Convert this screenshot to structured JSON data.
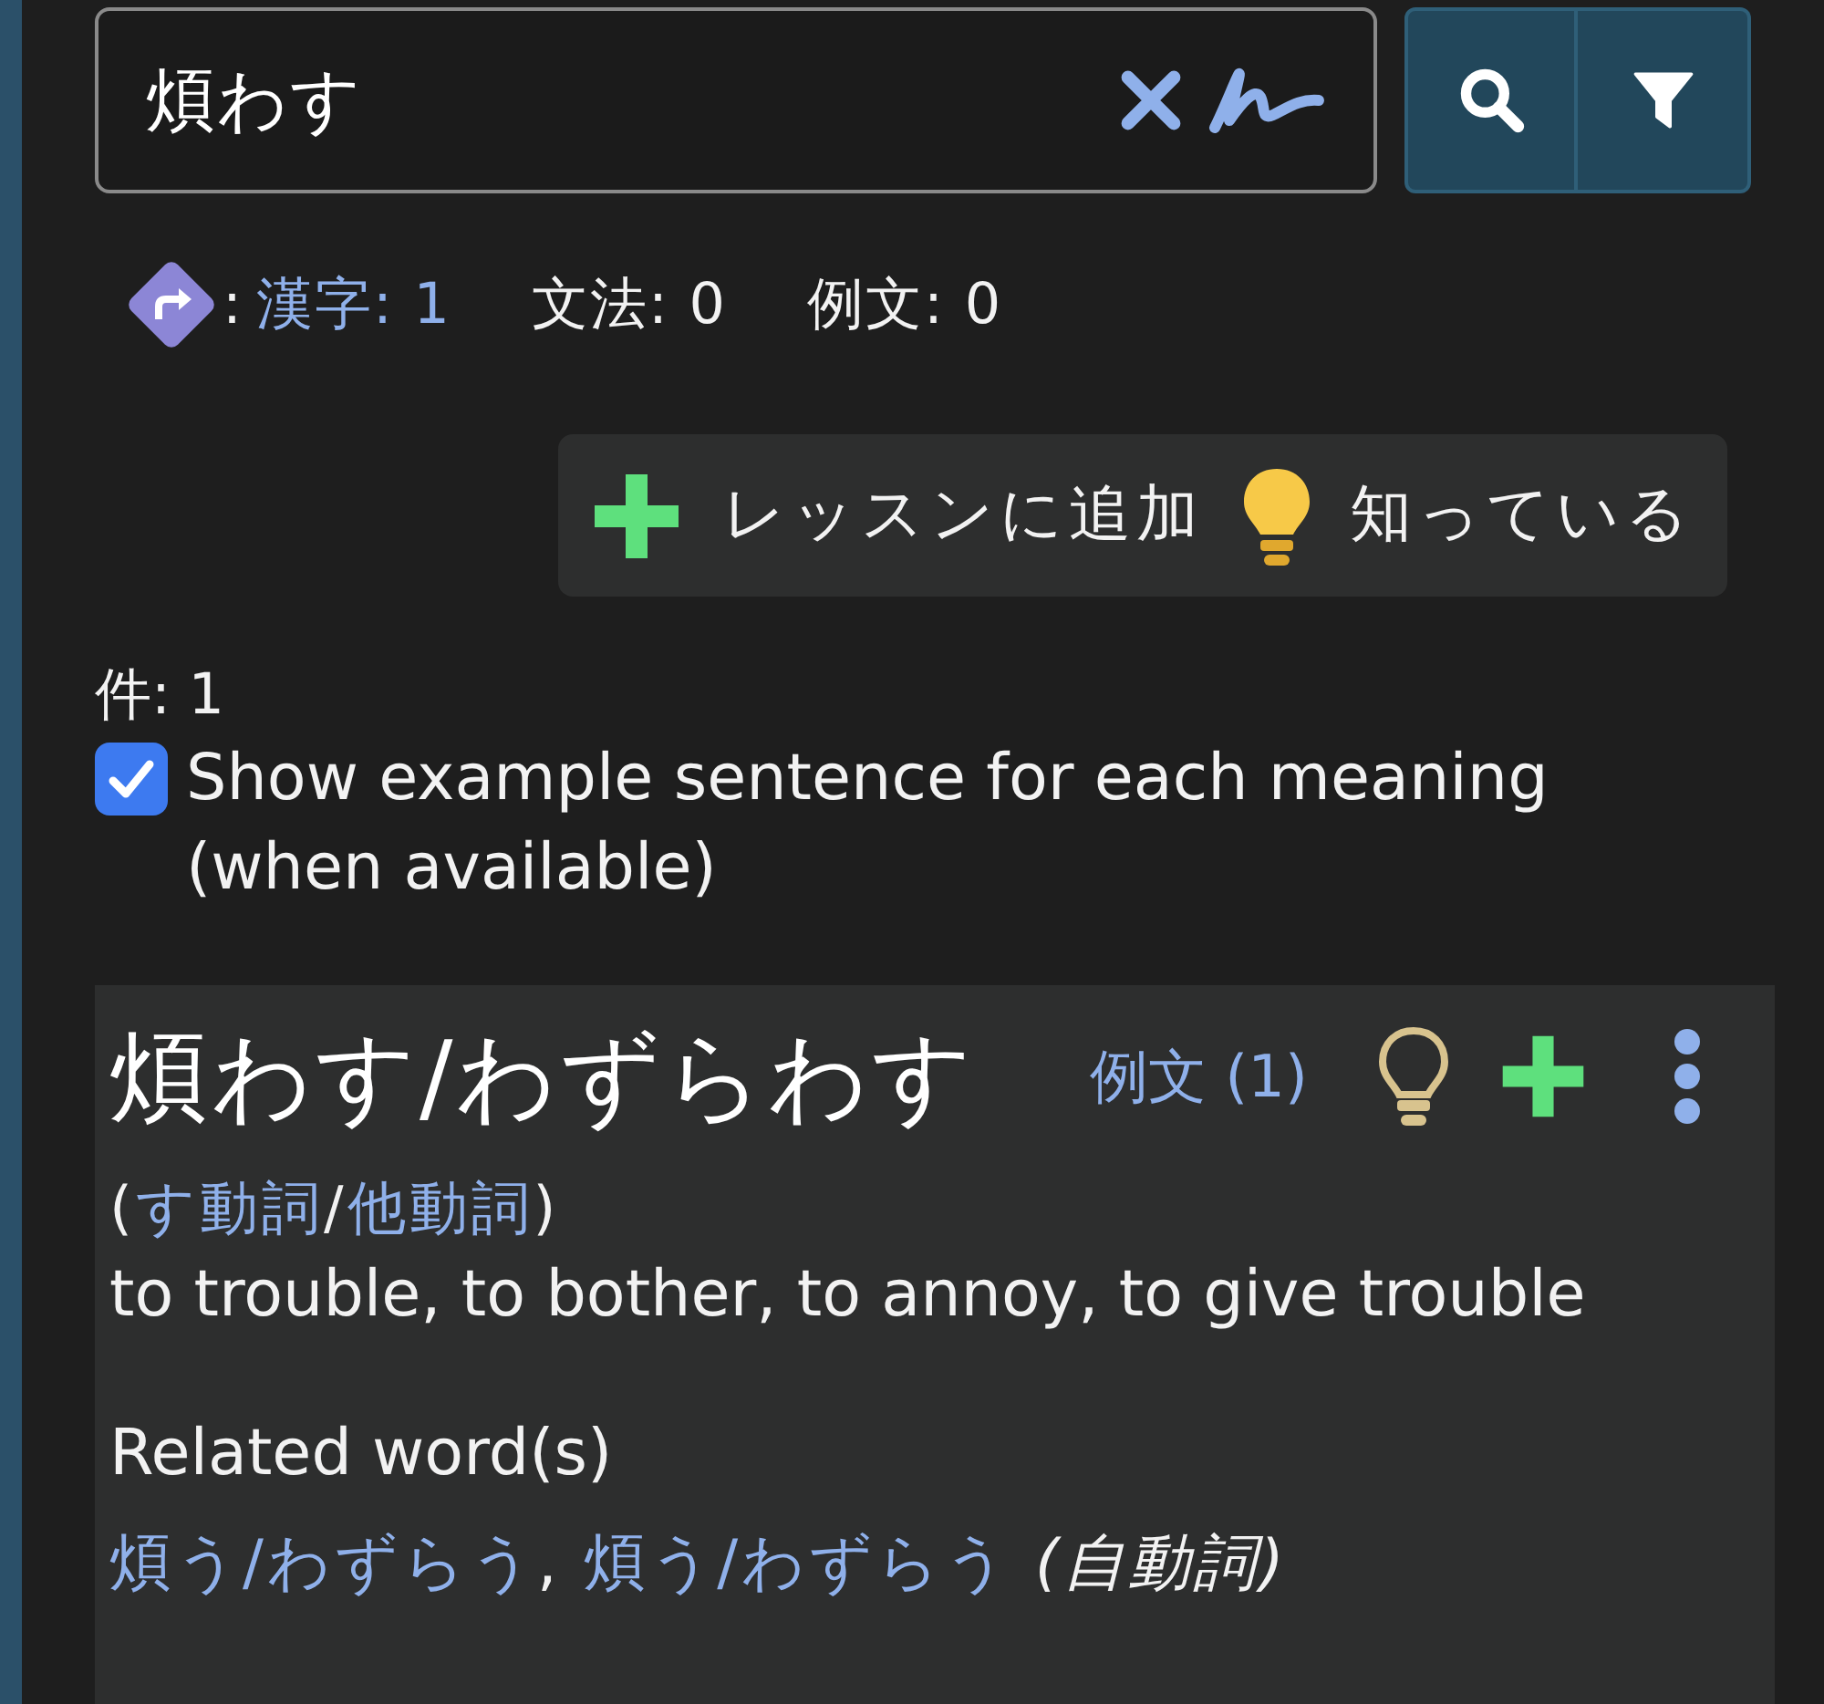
{
  "search": {
    "value": "煩わす"
  },
  "counts": {
    "prefix": ":",
    "items": [
      {
        "label": "漢字: 1",
        "kind": "link"
      },
      {
        "label": "文法: 0",
        "kind": "plain"
      },
      {
        "label": "例文: 0",
        "kind": "plain"
      }
    ]
  },
  "action_bar": [
    {
      "kind": "add",
      "label": "レッスンに追加"
    },
    {
      "kind": "known",
      "label": "知っている"
    }
  ],
  "result_count": "件: 1",
  "option": {
    "label": "Show example sentence for each meaning (when available)",
    "checked": true
  },
  "entry": {
    "title": "煩わす/わずらわす",
    "examples_link": "例文 (1)",
    "known": false,
    "part_of_speech": [
      {
        "text": "(",
        "kind": "plain"
      },
      {
        "text": "す動詞",
        "kind": "link"
      },
      {
        "text": "/",
        "kind": "plain"
      },
      {
        "text": "他動詞",
        "kind": "link"
      },
      {
        "text": ")",
        "kind": "plain"
      }
    ],
    "definition": "to trouble, to bother, to annoy, to give trouble",
    "related_heading": "Related word(s)",
    "related_words": [
      {
        "text": "煩う/わずらう",
        "kind": "link"
      },
      {
        "text": ", ",
        "kind": "plain"
      },
      {
        "text": "煩う/わずらう",
        "kind": "link"
      },
      {
        "text": " (自動詞)",
        "kind": "note"
      }
    ]
  }
}
